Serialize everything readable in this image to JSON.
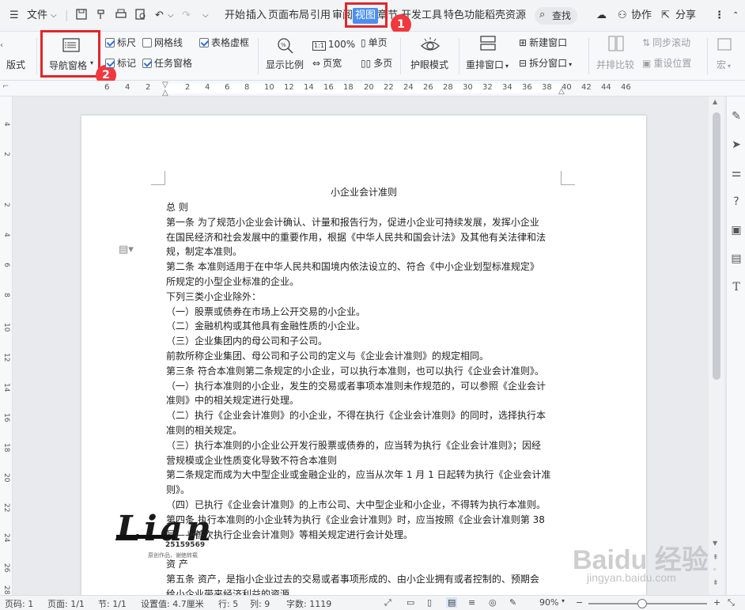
{
  "titlebar": {
    "menu_label": "文件",
    "search_label": "查找",
    "collab_label": "协作",
    "share_label": "分享"
  },
  "tabs": [
    "开始",
    "插入",
    "页面布局",
    "引用",
    "审阅",
    "视图",
    "章节",
    "开发工具",
    "特色功能",
    "稻壳资源"
  ],
  "active_tab": "视图",
  "ribbon": {
    "layout_label": "版式",
    "nav_pane_label": "导航窗格",
    "ruler_label": "标尺",
    "gridline_label": "网格线",
    "table_border_label": "表格虚框",
    "mark_label": "标记",
    "task_pane_label": "任务窗格",
    "zoom_label": "显示比例",
    "zoom_value": "100%",
    "page_width_label": "页宽",
    "single_page_label": "单页",
    "multi_page_label": "多页",
    "eye_label": "护眼模式",
    "rearrange_label": "重排窗口",
    "new_window_label": "新建窗口",
    "split_window_label": "拆分窗口",
    "side_by_side_label": "并排比较",
    "sync_scroll_label": "同步滚动",
    "reset_pos_label": "重设位置",
    "macro_label": "宏"
  },
  "checkboxes": {
    "ruler": true,
    "gridline": false,
    "table_border": true,
    "mark": true,
    "task_pane": true
  },
  "annotations": {
    "badge1": "1",
    "badge2": "2"
  },
  "ruler_numbers": [
    "6",
    "4",
    "2",
    "2",
    "4",
    "6",
    "8",
    "10",
    "12",
    "14",
    "16",
    "18",
    "20",
    "22",
    "24",
    "26",
    "28",
    "30",
    "32",
    "34",
    "36",
    "38",
    "40",
    "42",
    "44",
    "46"
  ],
  "vruler_numbers": [
    "4",
    "2",
    "2",
    "4",
    "6",
    "8",
    "10",
    "12",
    "14",
    "16",
    "18",
    "20",
    "22",
    "24",
    "26",
    "28"
  ],
  "document": {
    "title": "小企业会计准则",
    "lines": [
      "总 则",
      "第一条 为了规范小企业会计确认、计量和报告行为，促进小企业可持续发展，发挥小企业",
      "在国民经济和社会发展中的重要作用，根据《中华人民共和国会计法》及其他有关法律和法",
      "规，制定本准则。",
      "第二条 本准则适用于在中华人民共和国境内依法设立的、符合《中小企业划型标准规定》",
      "所规定的小型企业标准的企业。",
      "下列三类小企业除外：",
      "（一）股票或债券在市场上公开交易的小企业。",
      "（二）金融机构或其他具有金融性质的小企业。",
      "（三）企业集团内的母公司和子公司。",
      "前款所称企业集团、母公司和子公司的定义与《企业会计准则》的规定相同。",
      "第三条 符合本准则第二条规定的小企业，可以执行本准则，也可以执行《企业会计准则》。",
      "（一）执行本准则的小企业，发生的交易或者事项本准则未作规范的，可以参照《企业会计",
      "准则》中的相关规定进行处理。",
      "（二）执行《企业会计准则》的小企业，不得在执行《企业会计准则》的同时，选择执行本",
      "准则的相关规定。",
      "（三）执行本准则的小企业公开发行股票或债券的，应当转为执行《企业会计准则》；因经",
      "营规模或企业性质变化导致不符合本准则",
      "第二条规定而成为大中型企业或金融企业的，应当从次年 1 月 1 日起转为执行《企业会计准",
      "则》。",
      "（四）已执行《企业会计准则》的上市公司、大中型企业和小企业，不得转为执行本准则。",
      "第四条 执行本准则的小企业转为执行《企业会计准则》时，应当按照《企业会计准则第 38",
      "号——首次执行企业会计准则》等相关规定进行会计处理。",
      "",
      " 资 产",
      "第五条 资产，是指小企业过去的交易或者事项形成的、由小企业拥有或者控制的、预期会",
      "给小企业带来经济利益的资源。"
    ]
  },
  "watermark": {
    "lian": "Lian",
    "lian_small": "Lian",
    "number": "25159569",
    "note": "原创作品，谢绝转载",
    "baidu": "Baidu 经验",
    "baidu_url": "jingyan.baidu.com"
  },
  "statusbar": {
    "page": "页码: 1",
    "pages": "页面: 1/1",
    "section": "节: 1/1",
    "setting": "设置值: 4.7厘米",
    "row": "行: 5",
    "col": "列: 9",
    "words": "字数: 1119",
    "zoom": "90%"
  }
}
